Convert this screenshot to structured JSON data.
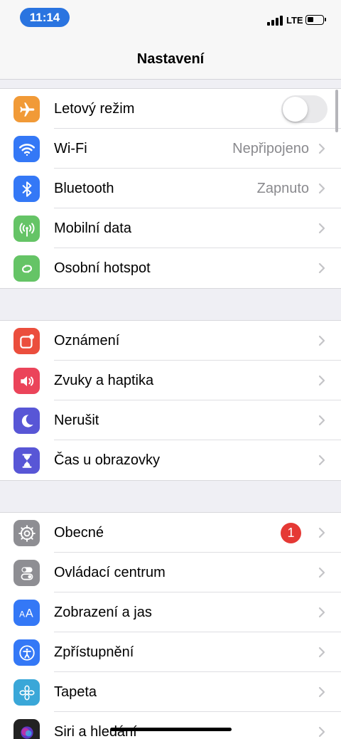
{
  "status_bar": {
    "time": "11:14",
    "network": "LTE"
  },
  "header": {
    "title": "Nastavení"
  },
  "groups": [
    {
      "rows": [
        {
          "label": "Letový režim",
          "icon": "airplane-icon",
          "color": "#f19a37",
          "control": "toggle",
          "toggle_on": false
        },
        {
          "label": "Wi-Fi",
          "value": "Nepřipojeno",
          "icon": "wifi-icon",
          "color": "#3478f6"
        },
        {
          "label": "Bluetooth",
          "value": "Zapnuto",
          "icon": "bluetooth-icon",
          "color": "#3478f6"
        },
        {
          "label": "Mobilní data",
          "icon": "antenna-icon",
          "color": "#65c466"
        },
        {
          "label": "Osobní hotspot",
          "icon": "hotspot-icon",
          "color": "#65c466"
        }
      ]
    },
    {
      "rows": [
        {
          "label": "Oznámení",
          "icon": "notifications-icon",
          "color": "#eb4e3d"
        },
        {
          "label": "Zvuky a haptika",
          "icon": "speaker-icon",
          "color": "#eb445a"
        },
        {
          "label": "Nerušit",
          "icon": "moon-icon",
          "color": "#5856d6"
        },
        {
          "label": "Čas u obrazovky",
          "icon": "hourglass-icon",
          "color": "#5856d6"
        }
      ]
    },
    {
      "rows": [
        {
          "label": "Obecné",
          "badge": "1",
          "icon": "gear-icon",
          "color": "#8e8e93"
        },
        {
          "label": "Ovládací centrum",
          "icon": "switches-icon",
          "color": "#8e8e93"
        },
        {
          "label": "Zobrazení a jas",
          "icon": "text-size-icon",
          "color": "#3478f6"
        },
        {
          "label": "Zpřístupnění",
          "icon": "accessibility-icon",
          "color": "#3478f6"
        },
        {
          "label": "Tapeta",
          "icon": "flower-icon",
          "color": "#3aa7d8"
        },
        {
          "label": "Siri a hledání",
          "icon": "siri-icon",
          "color": "#222"
        }
      ]
    }
  ]
}
